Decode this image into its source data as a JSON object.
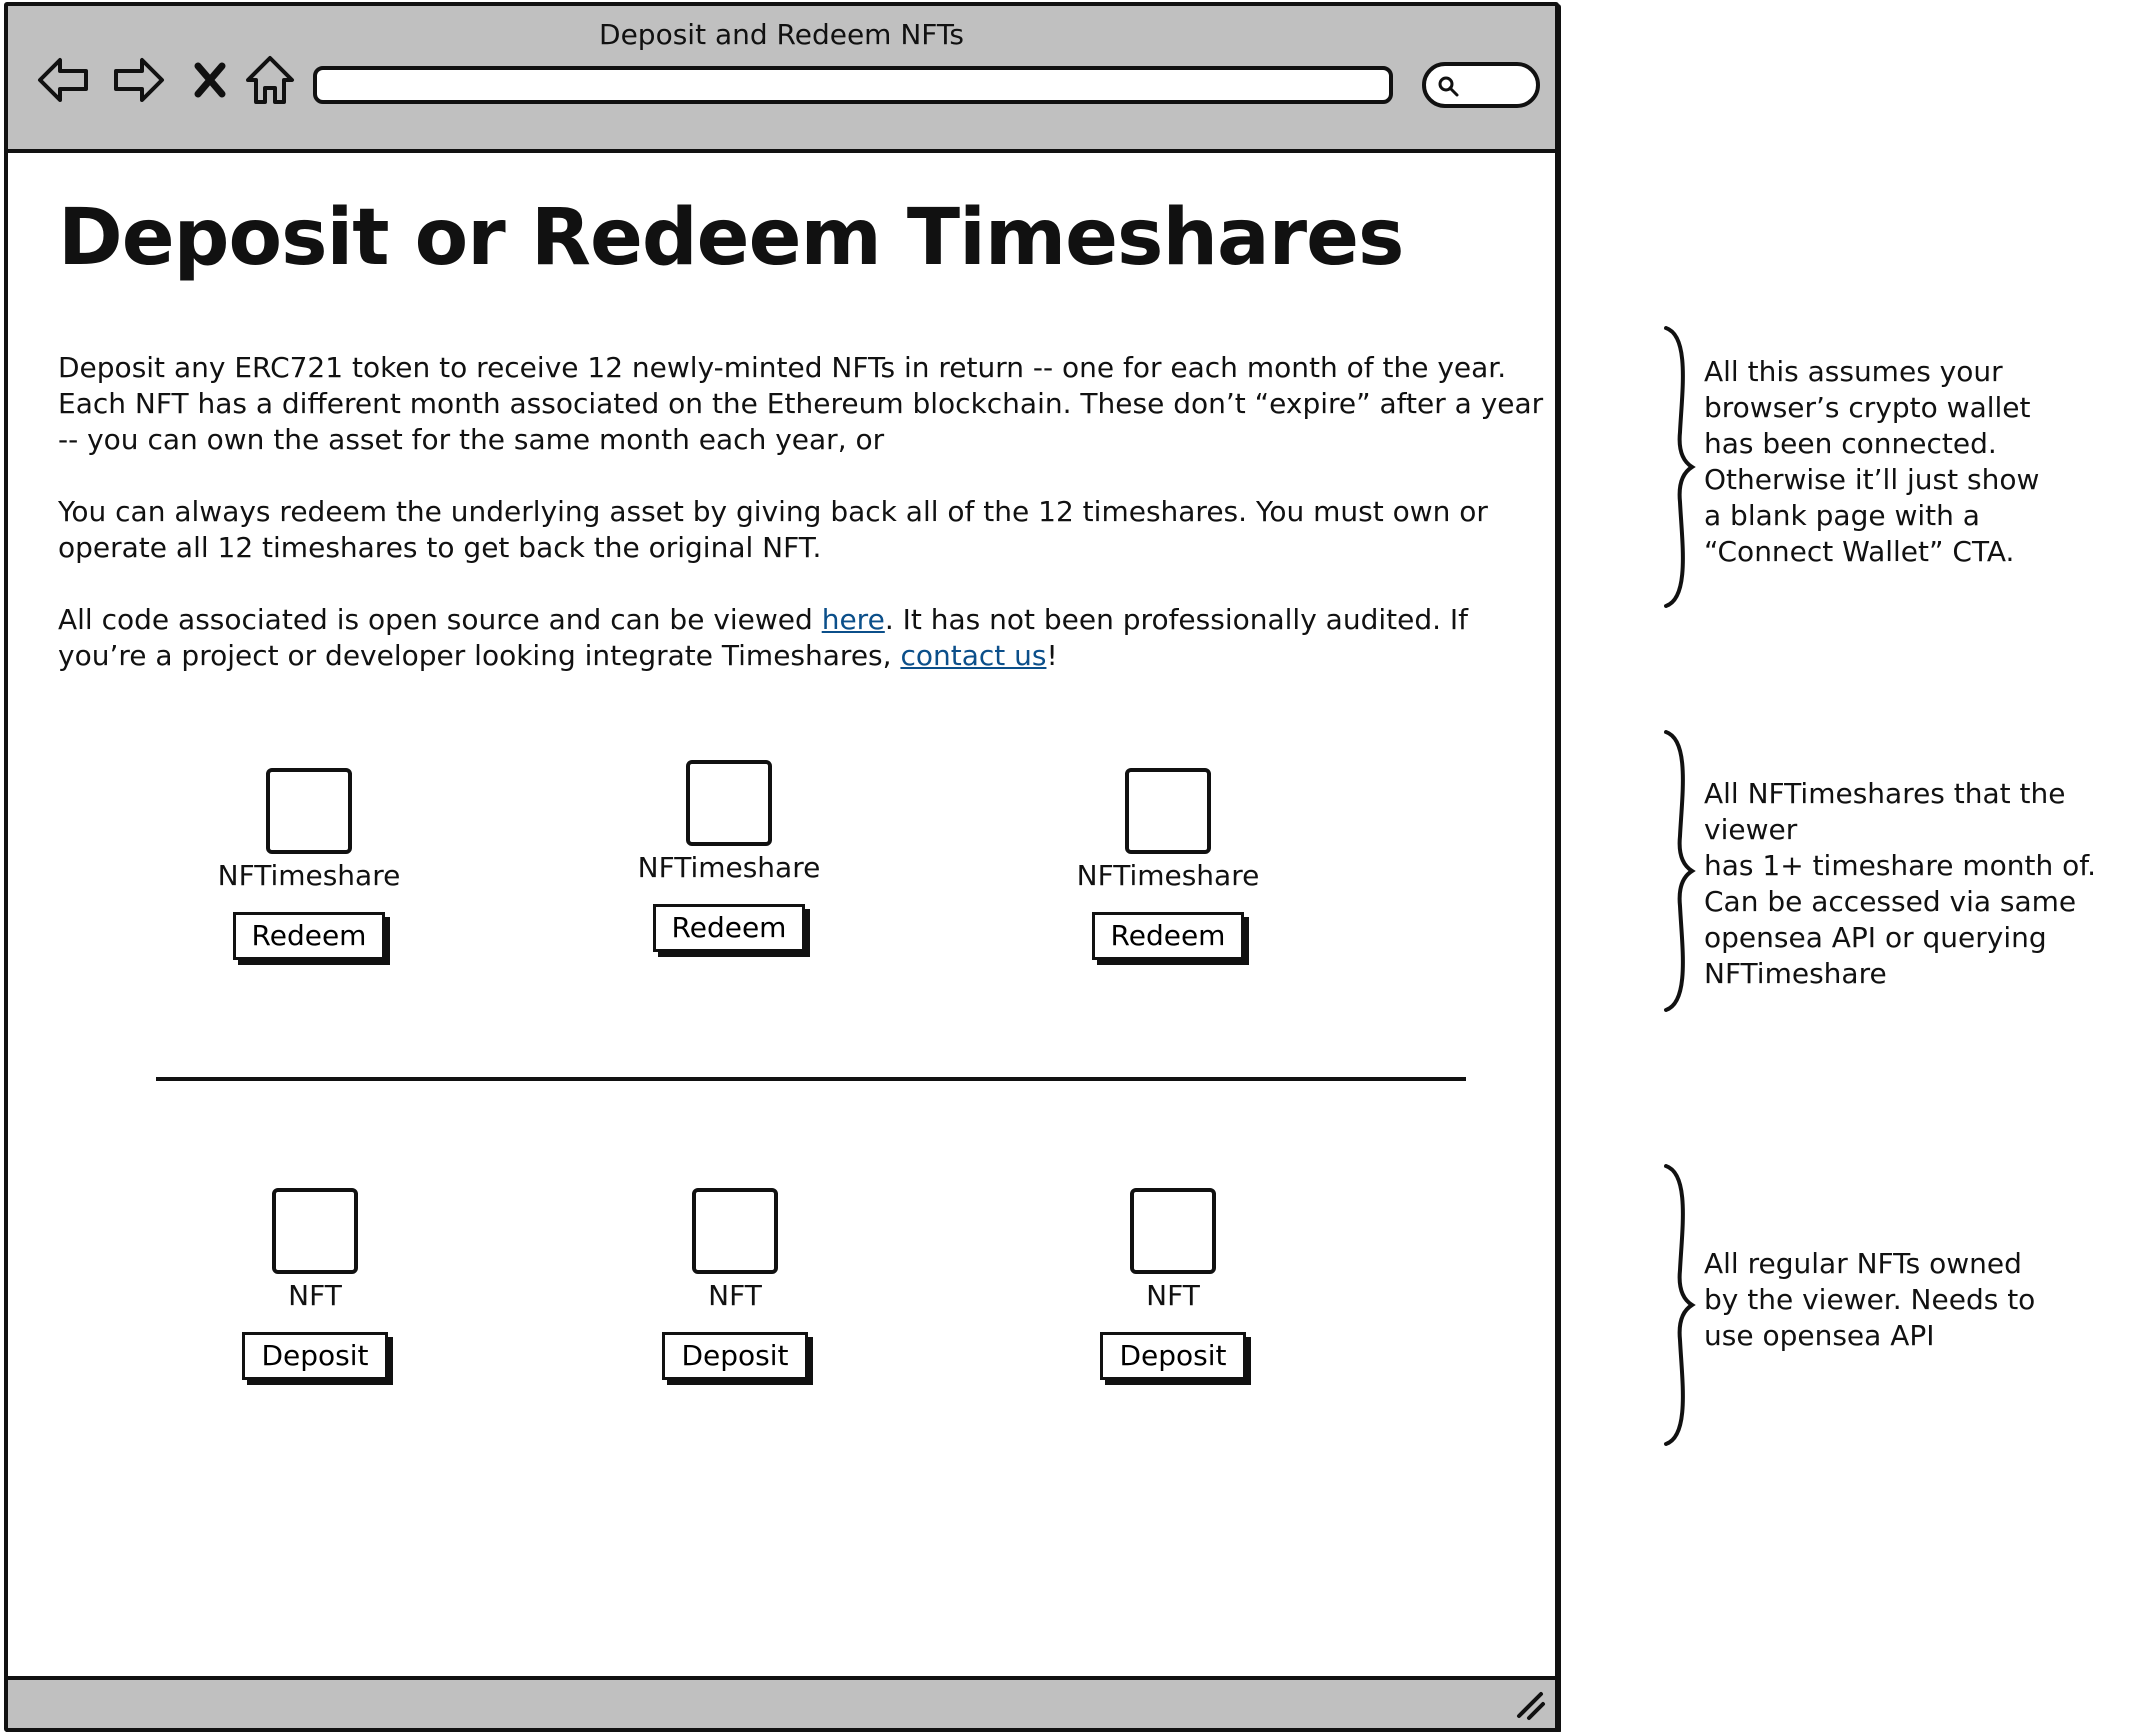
{
  "window": {
    "title": "Deposit and Redeem NFTs"
  },
  "nav": {
    "back": "back-arrow",
    "forward": "forward-arrow",
    "stop": "close-x",
    "home": "house"
  },
  "address_bar": {
    "value": ""
  },
  "search": {
    "value": ""
  },
  "page": {
    "title": "Deposit or Redeem Timeshares",
    "intro": "Deposit any ERC721 token to receive 12 newly-minted NFTs in return -- one for each month of the year. Each NFT has a different month associated on the Ethereum blockchain. These don’t “expire” after a year -- you can own the asset for the same month each year, or",
    "redeem_info": "You can always redeem the underlying asset by giving back all of the 12 timeshares. You must own or operate all 12 timeshares to get back the original NFT.",
    "code_info": {
      "before": "All code associated is open source and can be viewed ",
      "link1": "here",
      "middle": ". It has not been professionally audited. If you’re a project or developer looking integrate Timeshares, ",
      "link2": "contact us",
      "after": "!"
    }
  },
  "timeshares": [
    {
      "label": "NFTimeshare",
      "button": "Redeem"
    },
    {
      "label": "NFTimeshare",
      "button": "Redeem"
    },
    {
      "label": "NFTimeshare",
      "button": "Redeem"
    }
  ],
  "nfts": [
    {
      "label": "NFT",
      "button": "Deposit"
    },
    {
      "label": "NFT",
      "button": "Deposit"
    },
    {
      "label": "NFT",
      "button": "Deposit"
    }
  ],
  "annotations": [
    {
      "text": "All this assumes your\nbrowser’s crypto wallet\nhas been connected.\nOtherwise it’ll just show\na blank page with a\n“Connect Wallet” CTA."
    },
    {
      "text": "All NFTimeshares that the viewer\nhas 1+ timeshare month of.\nCan be accessed via same\nopensea API or querying\nNFTimeshare"
    },
    {
      "text": "All regular NFTs owned\nby the viewer. Needs to\nuse opensea API"
    }
  ],
  "colors": {
    "chrome": "#c0c0c0",
    "ink": "#111111",
    "link": "#0b4f8a"
  }
}
